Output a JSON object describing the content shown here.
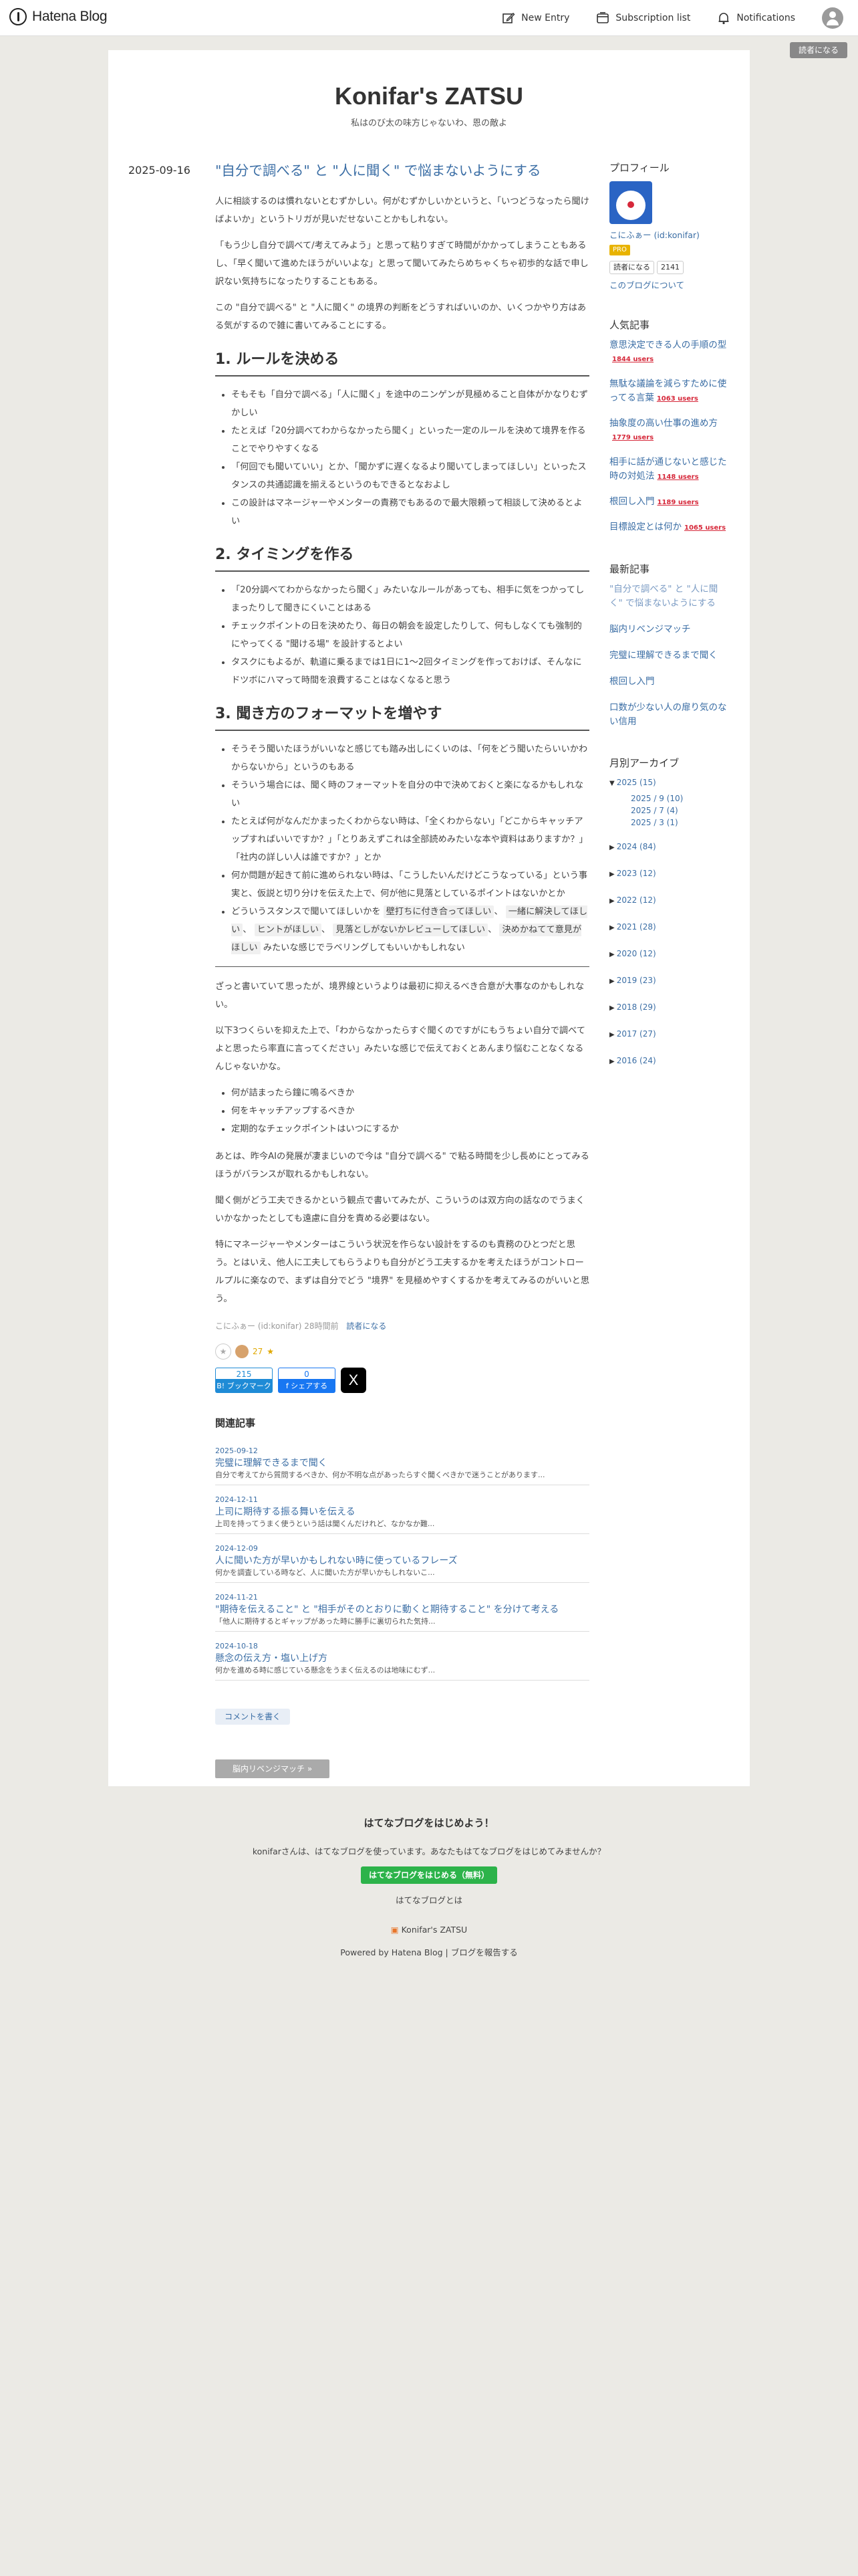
{
  "header": {
    "logo_text": "Hatena Blog",
    "new_entry": "New Entry",
    "subscription_list": "Subscription list",
    "notifications": "Notifications",
    "subscribe_button": "読者になる"
  },
  "blog": {
    "title": "Konifar's ZATSU",
    "description": "私はのび太の味方じゃないわ、恩の敵よ"
  },
  "entry": {
    "date": "2025-09-16",
    "title": "\"自分で調べる\" と \"人に聞く\" で悩まないようにする",
    "intro": [
      "人に相談するのは慣れないとむずかしい。何がむずかしいかというと、「いつどうなったら聞けばよいか」というトリガが見いだせないことかもしれない。",
      "「もう少し自分で調べて/考えてみよう」と思って粘りすぎて時間がかかってしまうこともあるし、「早く聞いて進めたほうがいいよな」と思って聞いてみたらめちゃくちゃ初歩的な話で申し訳ない気持ちになったりすることもある。",
      "この \"自分で調べる\" と \"人に聞く\" の境界の判断をどうすればいいのか、いくつかやり方はある気がするので雑に書いてみることにする。"
    ],
    "h1": "1. ルールを決める",
    "list1": [
      "そもそも「自分で調べる」「人に聞く」を途中のニンゲンが見極めること自体がかなりむずかしい",
      "たとえば「20分調べてわからなかったら聞く」といった一定のルールを決めて境界を作ることでやりやすくなる",
      "「何回でも聞いていい」とか、「聞かずに遅くなるより聞いてしまってほしい」といったスタンスの共通認識を揃えるというのもできるとなおよし",
      "この設計はマネージャーやメンターの責務でもあるので最大限頼って相談して決めるとよい"
    ],
    "h2": "2. タイミングを作る",
    "list2": [
      "「20分調べてわからなかったら聞く」みたいなルールがあっても、相手に気をつかってしまったりして聞きにくいことはある",
      "チェックポイントの日を決めたり、毎日の朝会を設定したりして、何もしなくても強制的にやってくる \"聞ける場\" を設計するとよい",
      "タスクにもよるが、軌道に乗るまでは1日に1〜2回タイミングを作っておけば、そんなにドツボにハマって時間を浪費することはなくなると思う"
    ],
    "h3": "3. 聞き方のフォーマットを増やす",
    "list3": [
      "そうそう聞いたほうがいいなと感じても踏み出しにくいのは、「何をどう聞いたらいいかわからないから」というのもある",
      "そういう場合には、聞く時のフォーマットを自分の中で決めておくと楽になるかもしれない",
      "たとえば何がなんだかまったくわからない時は、「全くわからない」「どこからキャッチアップすればいいですか？」「とりあえずこれは全部読めみたいな本や資料はありますか？」「社内の詳しい人は誰ですか？」とか",
      "何か問題が起きて前に進められない時は、「こうしたいんだけどこうなっている」という事実と、仮説と切り分けを伝えた上で、何が他に見落としているポイントはないかとか"
    ],
    "list3_last_prefix": "どういうスタンスで聞いてほしいかを",
    "tags": [
      "壁打ちに付き合ってほしい",
      "一緒に解決してほしい",
      "ヒントがほしい",
      "見落としがないかレビューしてほしい",
      "決めかねてて意見がほしい"
    ],
    "list3_last_suffix": "みたいな感じでラベリングしてもいいかもしれない",
    "conclusion": [
      "ざっと書いていて思ったが、境界線というよりは最初に抑えるべき合意が大事なのかもしれない。",
      "以下3つくらいを抑えた上で、「わからなかったらすぐ聞くのですがにもうちょい自分で調べてよと思ったら率直に言ってください」みたいな感じで伝えておくとあんまり悩むことなくなるんじゃないかな。"
    ],
    "list4": [
      "何が詰まったら鐘に鳴るべきか",
      "何をキャッチアップするべきか",
      "定期的なチェックポイントはいつにするか"
    ],
    "closing": [
      "あとは、昨今AIの発展が凄まじいので今は \"自分で調べる\" で粘る時間を少し長めにとってみるほうがバランスが取れるかもしれない。",
      "聞く側がどう工夫できるかという観点で書いてみたが、こういうのは双方向の話なのでうまくいかなかったとしても遠慮に自分を責める必要はない。",
      "特にマネージャーやメンターはこういう状況を作らない設計をするのも責務のひとつだと思う。とはいえ、他人に工夫してもらうよりも自分がどう工夫するかを考えたほうがコントロールプルに楽なので、まずは自分でどう \"境界\" を見極めやすくするかを考えてみるのがいいと思う。"
    ],
    "author": "こにふぁー (id:konifar) 28時間前",
    "subscribe_link": "読者になる",
    "star_count": "27",
    "hatebu_count": "215",
    "hatebu_label": "B! ブックマーク",
    "fb_count": "0",
    "fb_label": "f シェアする",
    "x_label": "X"
  },
  "related": {
    "title": "関連記事",
    "items": [
      {
        "date": "2025-09-12",
        "title": "完璧に理解できるまで聞く",
        "snippet": "自分で考えてから質問するべきか、何か不明な点があったらすぐ聞くべきかで迷うことがあります..."
      },
      {
        "date": "2024-12-11",
        "title": "上司に期待する振る舞いを伝える",
        "snippet": "上司を持ってうまく使うという話は聞くんだけれど、なかなか難..."
      },
      {
        "date": "2024-12-09",
        "title": "人に聞いた方が早いかもしれない時に使っているフレーズ",
        "snippet": "何かを調査している時など、人に聞いた方が早いかもしれないこ..."
      },
      {
        "date": "2024-11-21",
        "title": "\"期待を伝えること\" と \"相手がそのとおりに動くと期待すること\" を分けて考える",
        "snippet": "「他人に期待するとギャップがあった時に勝手に裏切られた気持..."
      },
      {
        "date": "2024-10-18",
        "title": "懸念の伝え方・塩い上げ方",
        "snippet": "何かを進める時に感じている懸念をうまく伝えるのは地味にむず..."
      }
    ],
    "comment_button": "コメントを書く",
    "pager_button": "脳内リベンジマッチ »"
  },
  "sidebar": {
    "profile_title": "プロフィール",
    "profile_name": "こにふぁー (id:konifar)",
    "pro_badge": "PRO",
    "subscribe_mini": "読者になる",
    "subscriber_count": "2141",
    "about": "このブログについて",
    "popular_title": "人気記事",
    "popular": [
      {
        "title": "意思決定できる人の手順の型",
        "users": "1844 users"
      },
      {
        "title": "無駄な議論を減らすために使ってる言葉",
        "users": "1063 users"
      },
      {
        "title": "抽象度の高い仕事の進め方",
        "users": "1779 users"
      },
      {
        "title": "相手に話が通じないと感じた時の対処法",
        "users": "1148 users"
      },
      {
        "title": "根回し入門",
        "users": "1189 users"
      },
      {
        "title": "目標設定とは何か",
        "users": "1065 users"
      }
    ],
    "recent_title": "最新記事",
    "recent": [
      "\"自分で調べる\" と \"人に聞く\" で悩まないようにする",
      "脳内リベンジマッチ",
      "完璧に理解できるまで聞く",
      "根回し入門",
      "口数が少ない人の扉り気のない信用"
    ],
    "archive_title": "月別アーカイブ",
    "archive": [
      {
        "label": "2025 (15)",
        "open": true,
        "months": [
          "2025 / 9 (10)",
          "2025 / 7 (4)",
          "2025 / 3 (1)"
        ]
      },
      {
        "label": "2024 (84)"
      },
      {
        "label": "2023 (12)"
      },
      {
        "label": "2022 (12)"
      },
      {
        "label": "2021 (28)"
      },
      {
        "label": "2020 (12)"
      },
      {
        "label": "2019 (23)"
      },
      {
        "label": "2018 (29)"
      },
      {
        "label": "2017 (27)"
      },
      {
        "label": "2016 (24)"
      }
    ]
  },
  "footer": {
    "title": "はてなブログをはじめよう！",
    "desc": "konifarさんは、はてなブログを使っています。あなたもはてなブログをはじめてみませんか？",
    "start_button": "はてなブログをはじめる（無料）",
    "what": "はてなブログとは",
    "brand": "Konifar's ZATSU",
    "powered": "Powered by Hatena Blog | ブログを報告する"
  },
  "colors": {
    "link": "#3b6ea5",
    "background": "#ebeae5",
    "users_red": "#d6283a",
    "start_green": "#2cb34a"
  }
}
